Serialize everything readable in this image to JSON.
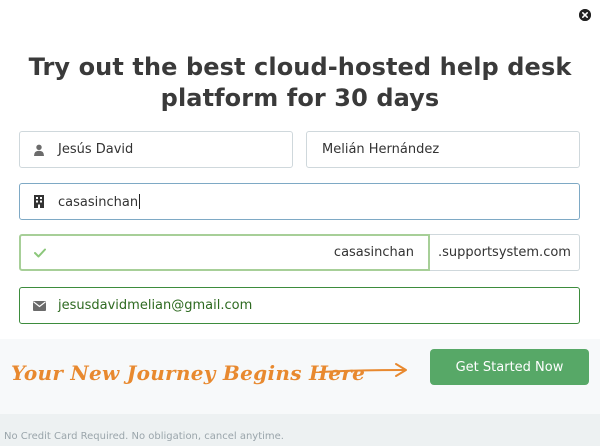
{
  "title": "Try out the best cloud-hosted help desk platform for 30 days",
  "form": {
    "first_name": "Jesús David",
    "last_name": "Melián Hernández",
    "company": "casasinchan",
    "subdomain": "casasinchan",
    "subdomain_suffix": ".supportsystem.com",
    "email": "jesusdavidmelian@gmail.com"
  },
  "tagline": "Your New Journey Begins Here",
  "cta_label": "Get Started Now",
  "fine_print": "No Credit Card Required. No obligation, cancel anytime.",
  "icons": {
    "close": "close-icon",
    "user": "user-icon",
    "building": "building-icon",
    "check": "check-icon",
    "email": "envelope-icon",
    "arrow": "arrow-right-icon"
  },
  "colors": {
    "cta": "#57a867",
    "tagline": "#e8892f",
    "valid_border": "#3d8c3d",
    "focus_border": "#7ea9c5"
  }
}
